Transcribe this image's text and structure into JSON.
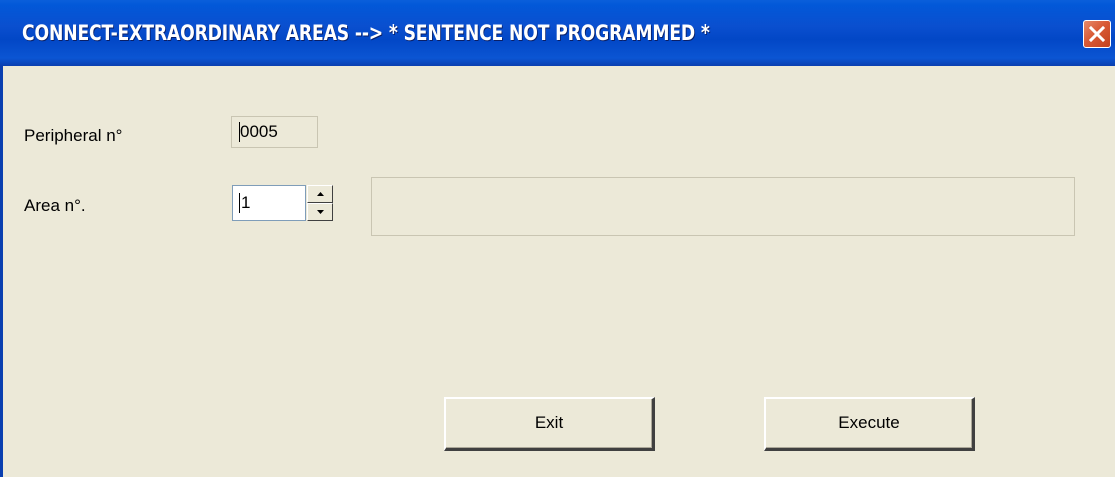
{
  "window": {
    "title": "CONNECT-EXTRAORDINARY AREAS --> * SENTENCE NOT PROGRAMMED *"
  },
  "form": {
    "peripheral_label": "Peripheral n°",
    "peripheral_value": "0005",
    "area_label": "Area n°.",
    "area_value": "1",
    "area_description": ""
  },
  "buttons": {
    "exit_label": "Exit",
    "execute_label": "Execute"
  },
  "icons": {
    "close": "close-icon",
    "spin_up": "arrow-up-icon",
    "spin_down": "arrow-down-icon"
  },
  "colors": {
    "titlebar": "#0a4fcf",
    "close_button": "#d95a35",
    "dialog_background": "#ece9d8"
  }
}
